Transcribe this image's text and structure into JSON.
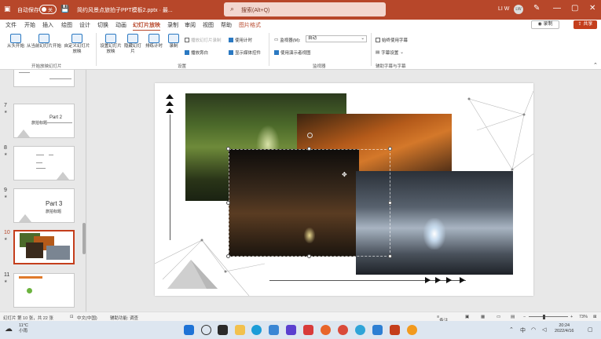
{
  "titlebar": {
    "autosave_label": "自动保存",
    "autosave_state": "关",
    "doc_title": "简约风景点旅拍子PPT模板2.pptx · 最...",
    "search_placeholder": "搜索(Alt+Q)",
    "user_name": "LI W",
    "user_initials": "LW"
  },
  "tabs": [
    "文件",
    "开始",
    "插入",
    "绘图",
    "设计",
    "切换",
    "动画",
    "幻灯片放映",
    "录制",
    "审阅",
    "视图",
    "帮助",
    "图片格式"
  ],
  "active_tab": "幻灯片放映",
  "buttons": {
    "record": "录制",
    "share": "共享"
  },
  "ribbon": {
    "start_group": {
      "from_beginning": "从头开始",
      "from_current": "从当前幻灯片开始",
      "custom": "自定义幻灯片放映",
      "label": "开始放映幻灯片"
    },
    "setup_group": {
      "setup": "设置幻灯片放映",
      "hide": "隐藏幻灯片",
      "rehearse": "排练计时",
      "record": "录制",
      "play_narration": "播放旁白",
      "use_timings": "使用计时",
      "show_media": "显示媒体控件",
      "hide_disabled": "播放幻灯片录制",
      "label": "设置"
    },
    "monitor_group": {
      "monitor_label": "监视器(M):",
      "monitor_value": "自动",
      "presenter_view": "使用演示者视图",
      "label": "监视器"
    },
    "captions_group": {
      "always_subtitles": "始终使用字幕",
      "subtitle_settings": "字幕设置",
      "label": "辅助字幕与字幕"
    }
  },
  "slides": [
    {
      "num": "7",
      "title": "Part 2",
      "subtitle": "旅拍标题"
    },
    {
      "num": "8",
      "title": "",
      "subtitle": ""
    },
    {
      "num": "9",
      "title": "Part 3",
      "subtitle": "旅拍标题"
    },
    {
      "num": "10",
      "title": "",
      "subtitle": ""
    },
    {
      "num": "11",
      "title": "",
      "subtitle": ""
    }
  ],
  "statusbar": {
    "slide_info": "幻灯片 第 10 张，共 22 张",
    "language": "中文(中国)",
    "accessibility": "辅助功能: 调查",
    "notes": "备注",
    "zoom": "73%"
  },
  "taskbar": {
    "weather_temp": "11°C",
    "weather_desc": "小雨",
    "time": "20:24",
    "date": "2022/4/16"
  },
  "colors": {
    "accent": "#b7472a",
    "share": "#c43e1c"
  }
}
